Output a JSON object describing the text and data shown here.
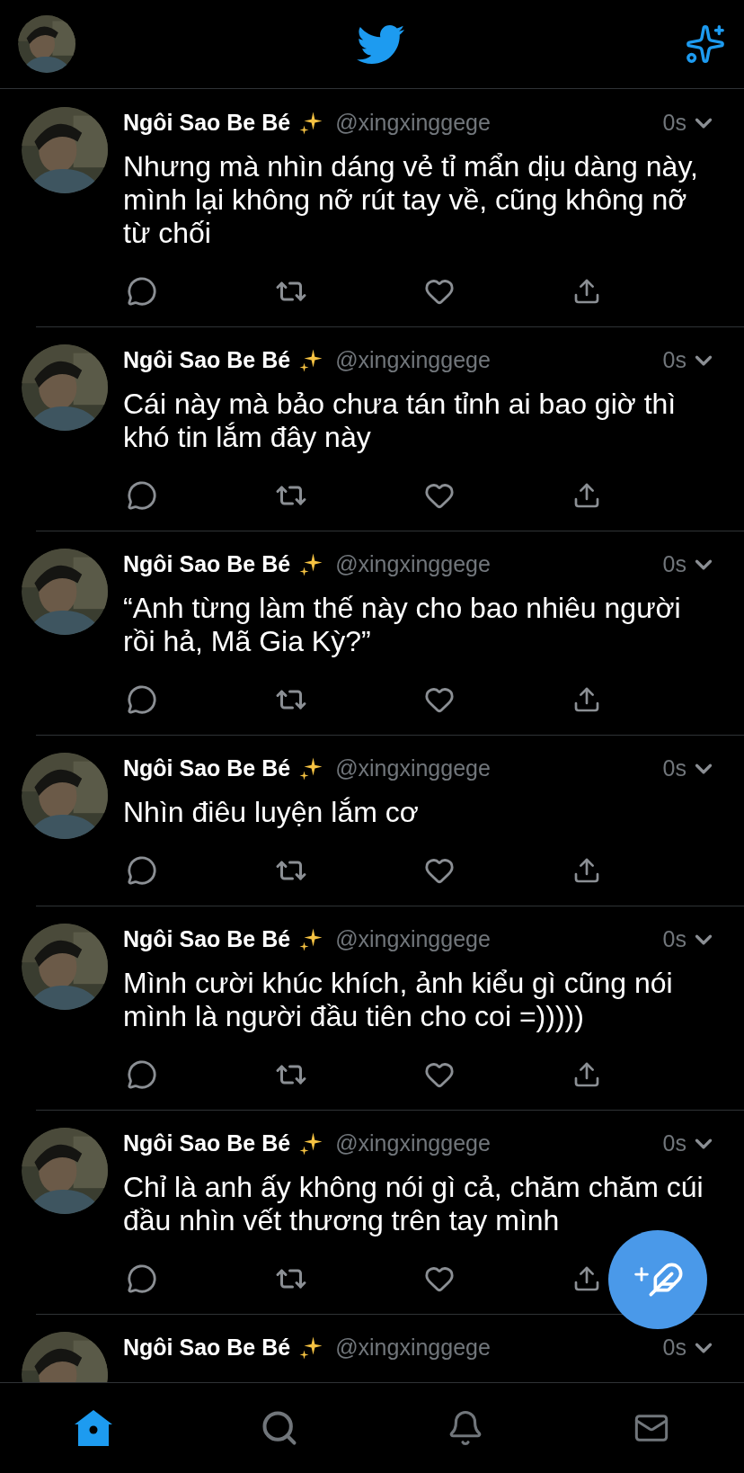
{
  "tweets": [
    {
      "name": "Ngôi Sao Be Bé",
      "handle": "@xingxinggege",
      "time": "0s",
      "body": "Nhưng mà nhìn dáng vẻ tỉ mẩn dịu dàng này, mình lại không nỡ rút tay về, cũng không nỡ từ chối"
    },
    {
      "name": "Ngôi Sao Be Bé",
      "handle": "@xingxinggege",
      "time": "0s",
      "body": "Cái này mà bảo chưa tán tỉnh ai bao giờ thì khó tin lắm đây này"
    },
    {
      "name": "Ngôi Sao Be Bé",
      "handle": "@xingxinggege",
      "time": "0s",
      "body": "“Anh từng làm thế này cho bao nhiêu người rồi hả, Mã Gia Kỳ?”"
    },
    {
      "name": "Ngôi Sao Be Bé",
      "handle": "@xingxinggege",
      "time": "0s",
      "body": "Nhìn điêu luyện lắm cơ"
    },
    {
      "name": "Ngôi Sao Be Bé",
      "handle": "@xingxinggege",
      "time": "0s",
      "body": "Mình cười khúc khích, ảnh kiểu gì cũng nói mình là người đầu tiên cho coi =)))))"
    },
    {
      "name": "Ngôi Sao Be Bé",
      "handle": "@xingxinggege",
      "time": "0s",
      "body": "Chỉ là anh ấy không nói gì cả, chăm chăm cúi đầu nhìn vết thương trên tay mình"
    },
    {
      "name": "Ngôi Sao Be Bé",
      "handle": "@xingxinggege",
      "time": "0s"
    }
  ],
  "tabs": [
    {
      "kind": "home",
      "selected": true
    },
    {
      "kind": "search",
      "selected": false
    },
    {
      "kind": "notifications",
      "selected": false
    },
    {
      "kind": "messages",
      "selected": false
    }
  ]
}
